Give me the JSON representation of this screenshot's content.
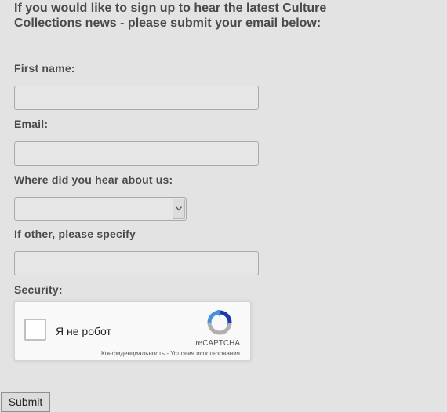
{
  "intro": {
    "line1": "If you would like to sign up to hear the latest Culture",
    "line2": "Collections news - please submit your email below:"
  },
  "form": {
    "first_name_label": "First name:",
    "first_name_value": "",
    "email_label": "Email:",
    "email_value": "",
    "hear_label": "Where did you hear about us:",
    "hear_selected": "",
    "other_label": "If other, please specify",
    "other_value": "",
    "security_label": "Security:"
  },
  "recaptcha": {
    "checkbox_label": "Я не робот",
    "brand": "reCAPTCHA",
    "privacy_link": "Конфиденциальность",
    "separator": " - ",
    "terms_link": "Условия использования"
  },
  "submit": {
    "label": "Submit"
  },
  "icons": {
    "select_arrow": "chevron-down-icon",
    "recaptcha_logo": "recaptcha-logo-icon"
  },
  "colors": {
    "background": "#e3e3e3",
    "label_text": "#4a4a4a",
    "recaptcha_blue": "#4a90e2",
    "recaptcha_dark_blue": "#1c3aa9",
    "recaptcha_gray": "#b0b0b0"
  }
}
